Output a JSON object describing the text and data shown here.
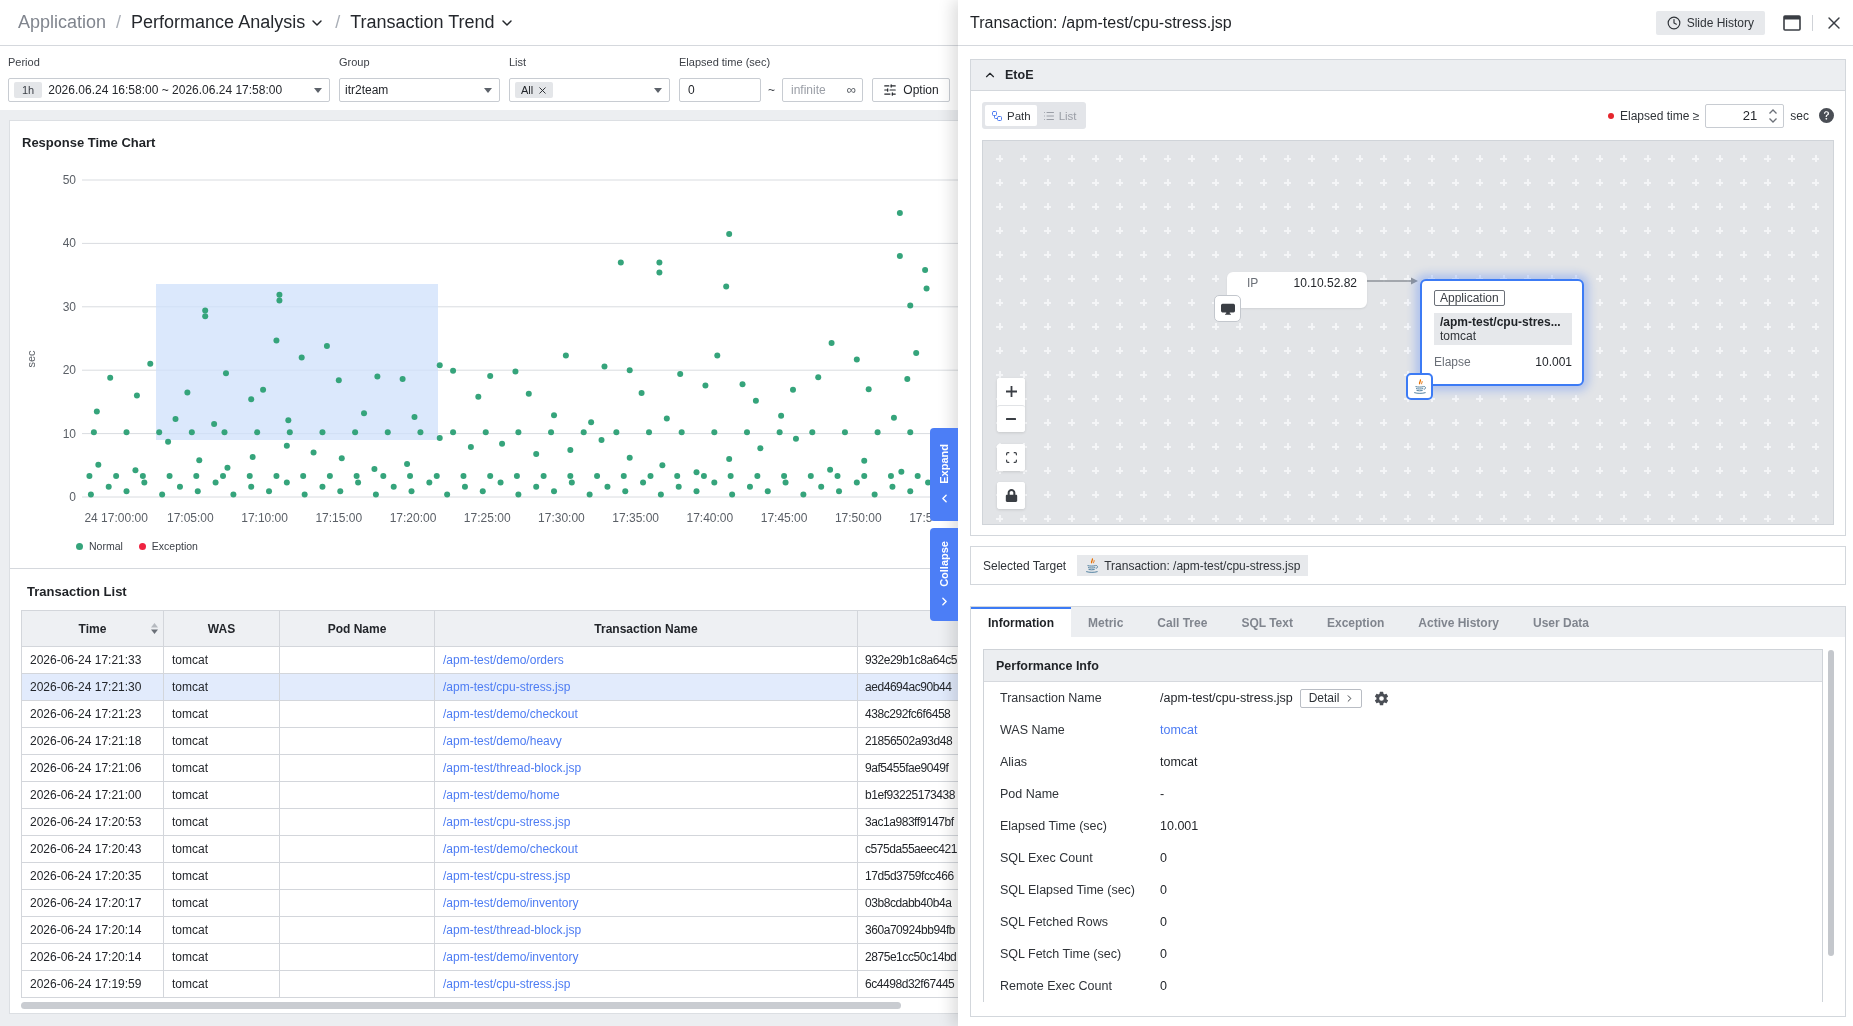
{
  "breadcrumb": [
    {
      "label": "Application",
      "dropdown": false
    },
    {
      "separator": "/",
      "label": "Performance Analysis",
      "dropdown": true
    },
    {
      "separator": "/",
      "label": "Transaction Trend",
      "dropdown": true
    }
  ],
  "filters": {
    "period": {
      "label": "Period",
      "range_badge": "1h",
      "value": "2026.06.24 16:58:00 ~ 2026.06.24 17:58:00"
    },
    "group": {
      "label": "Group",
      "value": "itr2team"
    },
    "list": {
      "label": "List",
      "chips": [
        "All"
      ]
    },
    "elapsed_time": {
      "label": "Elapsed time (sec)",
      "min_value": "0",
      "separator": "~",
      "max_placeholder": "infinite",
      "max_symbol": "∞"
    },
    "option_button": "Option"
  },
  "response_chart": {
    "chart_data": {
      "type": "scatter",
      "title": "Response Time Chart",
      "ylabel": "sec",
      "grid": true,
      "xlim": [
        61062,
        64603
      ],
      "ylim": [
        0,
        50
      ],
      "xticks": [
        {
          "value": 61200,
          "label": "24 17:00:00"
        },
        {
          "value": 61500,
          "label": "17:05:00"
        },
        {
          "value": 61800,
          "label": "17:10:00"
        },
        {
          "value": 62100,
          "label": "17:15:00"
        },
        {
          "value": 62400,
          "label": "17:20:00"
        },
        {
          "value": 62700,
          "label": "17:25:00"
        },
        {
          "value": 63000,
          "label": "17:30:00"
        },
        {
          "value": 63300,
          "label": "17:35:00"
        },
        {
          "value": 63600,
          "label": "17:40:00"
        },
        {
          "value": 63900,
          "label": "17:45:00"
        },
        {
          "value": 64200,
          "label": "17:50:00"
        },
        {
          "value": 64500,
          "label": "17:5"
        }
      ],
      "yticks": [
        0,
        10,
        20,
        30,
        40,
        50
      ],
      "x": [
        61098,
        61170,
        61242,
        61314,
        61386,
        61458,
        61530,
        61602,
        61674,
        61746,
        61818,
        61890,
        61962,
        62034,
        62106,
        62178,
        62250,
        62322,
        62394,
        62466,
        62538,
        62610,
        62682,
        62754,
        62826,
        62898,
        62970,
        63042,
        63114,
        63186,
        63258,
        63330,
        63402,
        63474,
        63546,
        63618,
        63690,
        63762,
        63834,
        63906,
        63978,
        64050,
        64122,
        64194,
        64266,
        64338,
        64410,
        64482,
        61092,
        61200,
        61308,
        61416,
        61524,
        61632,
        61740,
        61848,
        61956,
        62064,
        62172,
        62280,
        62388,
        62496,
        62604,
        62712,
        62820,
        62928,
        63036,
        63144,
        63252,
        63360,
        63468,
        63576,
        63684,
        63792,
        63900,
        64008,
        64116,
        64224,
        64332,
        64440,
        61110,
        61242,
        61374,
        61506,
        61638,
        61770,
        61902,
        62034,
        62166,
        62298,
        62430,
        62562,
        62694,
        62826,
        62958,
        63090,
        63222,
        63354,
        63486,
        63618,
        63750,
        63882,
        64014,
        64146,
        64278,
        64410,
        61128,
        61278,
        61410,
        61536,
        61650,
        61752,
        61890,
        61998,
        62112,
        62244,
        62376,
        62508,
        62634,
        62760,
        62898,
        63036,
        63162,
        63276,
        63408,
        63546,
        63678,
        63804,
        63948,
        64086,
        64224,
        64374,
        61122,
        61176,
        61284,
        61338,
        61440,
        61488,
        61596,
        61644,
        61746,
        61794,
        61848,
        61896,
        61950,
        62052,
        62100,
        62202,
        62256,
        62358,
        62406,
        62508,
        62562,
        62664,
        62712,
        62814,
        62868,
        62970,
        63018,
        63120,
        63174,
        63276,
        63324,
        63426,
        63480,
        63582,
        63630,
        63732,
        63786,
        63888,
        63936,
        64038,
        64092,
        64194,
        64242,
        64344,
        64398,
        61560,
        61560,
        61860,
        61860,
        63240,
        63396,
        63396,
        63678,
        63666,
        64368,
        64368,
        64410,
        64470,
        64476,
        64434
      ],
      "series": [
        {
          "name": "Normal",
          "color": "#35a47b",
          "values": [
            0.4,
            1.6,
            0.9,
            2.3,
            0.4,
            1.6,
            0.9,
            2.3,
            0.4,
            1.6,
            0.9,
            2.3,
            0.4,
            1.6,
            0.9,
            2.3,
            0.4,
            1.6,
            0.9,
            2.3,
            0.4,
            1.6,
            0.9,
            2.3,
            0.4,
            1.6,
            0.9,
            2.3,
            0.4,
            1.6,
            0.9,
            2.3,
            0.4,
            1.6,
            0.9,
            2.3,
            0.4,
            1.6,
            0.9,
            2.3,
            0.4,
            1.6,
            0.9,
            2.3,
            0.4,
            1.6,
            0.9,
            2.3,
            3.3,
            3.3,
            3.3,
            3.3,
            3.3,
            3.3,
            3.3,
            3.3,
            3.3,
            3.3,
            3.3,
            3.3,
            3.3,
            3.3,
            3.3,
            3.3,
            3.3,
            3.3,
            3.3,
            3.3,
            3.3,
            3.3,
            3.3,
            3.3,
            3.3,
            3.3,
            3.3,
            3.3,
            3.3,
            3.3,
            3.3,
            3.3,
            10.2,
            10.2,
            10.2,
            10.2,
            10.2,
            10.2,
            10.2,
            10.2,
            10.2,
            10.2,
            10.2,
            10.2,
            10.2,
            10.2,
            10.2,
            10.2,
            10.2,
            10.2,
            10.2,
            10.2,
            10.2,
            10.2,
            10.2,
            10.2,
            10.2,
            10.2,
            5.1,
            4.2,
            8.7,
            5.8,
            4.6,
            6.3,
            8.1,
            7.0,
            6.1,
            4.4,
            5.2,
            9.3,
            7.9,
            8.4,
            6.8,
            7.4,
            9.0,
            6.2,
            5.0,
            3.9,
            6.0,
            7.7,
            9.2,
            4.3,
            5.7,
            4.0,
            13.5,
            18.8,
            16.0,
            21.0,
            12.3,
            16.5,
            11.5,
            19.5,
            15.4,
            16.9,
            24.7,
            12.1,
            22.0,
            23.8,
            18.4,
            13.2,
            19.0,
            18.6,
            12.6,
            20.8,
            19.9,
            15.8,
            19.1,
            19.8,
            16.3,
            12.9,
            22.3,
            11.8,
            20.6,
            20.0,
            16.4,
            12.4,
            19.4,
            17.6,
            22.3,
            17.8,
            15.2,
            12.8,
            16.9,
            18.9,
            24.3,
            21.7,
            17.0,
            12.5,
            18.6,
            29.4,
            28.5,
            31.9,
            31.0,
            37.0,
            37.0,
            35.4,
            41.5,
            33.2,
            44.8,
            38.0,
            30.2,
            35.8,
            32.9,
            22.7
          ]
        }
      ]
    },
    "legend": [
      {
        "label": "Exception",
        "color": "#ef2341"
      }
    ]
  },
  "transaction_list": {
    "title": "Transaction List",
    "columns": [
      {
        "label": "Time",
        "sortable": true
      },
      {
        "label": "WAS",
        "sortable": false
      },
      {
        "label": "Pod Name",
        "sortable": false
      },
      {
        "label": "Transaction Name",
        "sortable": false
      }
    ],
    "rows": [
      {
        "time": "2026-06-24 17:21:33",
        "was": "tomcat",
        "transaction_name": "/apm-test/demo/orders",
        "column_5": "932e29b1c8a64c5",
        "selected": false
      },
      {
        "time": "2026-06-24 17:21:30",
        "was": "tomcat",
        "transaction_name": "/apm-test/cpu-stress.jsp",
        "column_5": "aed4694ac90b44",
        "selected": true
      },
      {
        "time": "2026-06-24 17:21:23",
        "was": "tomcat",
        "transaction_name": "/apm-test/demo/checkout",
        "column_5": "438c292fc6f6458",
        "selected": false
      },
      {
        "time": "2026-06-24 17:21:18",
        "was": "tomcat",
        "transaction_name": "/apm-test/demo/heavy",
        "column_5": "21856502a93d48",
        "selected": false
      },
      {
        "time": "2026-06-24 17:21:06",
        "was": "tomcat",
        "transaction_name": "/apm-test/thread-block.jsp",
        "column_5": "9af5455fae9049f",
        "selected": false
      },
      {
        "time": "2026-06-24 17:21:00",
        "was": "tomcat",
        "transaction_name": "/apm-test/demo/home",
        "column_5": "b1ef93225173438",
        "selected": false
      },
      {
        "time": "2026-06-24 17:20:53",
        "was": "tomcat",
        "transaction_name": "/apm-test/cpu-stress.jsp",
        "column_5": "3ac1a983ff9147bf",
        "selected": false
      },
      {
        "time": "2026-06-24 17:20:43",
        "was": "tomcat",
        "transaction_name": "/apm-test/demo/checkout",
        "column_5": "c575da55aeec421",
        "selected": false
      },
      {
        "time": "2026-06-24 17:20:35",
        "was": "tomcat",
        "transaction_name": "/apm-test/cpu-stress.jsp",
        "column_5": "17d5d3759fcc466",
        "selected": false
      },
      {
        "time": "2026-06-24 17:20:17",
        "was": "tomcat",
        "transaction_name": "/apm-test/demo/inventory",
        "column_5": "03b8cdabb40b4a",
        "selected": false
      },
      {
        "time": "2026-06-24 17:20:14",
        "was": "tomcat",
        "transaction_name": "/apm-test/thread-block.jsp",
        "column_5": "360a70924bb94fb",
        "selected": false
      },
      {
        "time": "2026-06-24 17:20:14",
        "was": "tomcat",
        "transaction_name": "/apm-test/demo/inventory",
        "column_5": "2875e1cc50c14bd",
        "selected": false
      },
      {
        "time": "2026-06-24 17:19:59",
        "was": "tomcat",
        "transaction_name": "/apm-test/cpu-stress.jsp",
        "column_5": "6c4498d32f67445",
        "selected": false
      }
    ]
  },
  "panel_tabs": [
    {
      "kind": "expand",
      "label": "Expand"
    },
    {
      "kind": "collapse",
      "label": "Collapse"
    }
  ],
  "drawer": {
    "title": "Transaction: /apm-test/cpu-stress.jsp",
    "history_button": "Slide History",
    "etoe": {
      "title": "EtoE",
      "expanded": true,
      "view_toggle": [
        {
          "kind": "path",
          "label": "Path",
          "selected": true
        },
        {
          "kind": "list",
          "label": "List",
          "selected": false
        }
      ],
      "threshold": {
        "label": "Elapsed time ≥",
        "value": "21",
        "unit": "sec"
      },
      "nodes": [
        {
          "kind": "client",
          "label": "IP",
          "value": "10.10.52.82",
          "selected": false
        },
        {
          "kind": "application",
          "tag": "Application",
          "name": "/apm-test/cpu-stres...",
          "server": "tomcat",
          "metric_label": "Elapse",
          "metric_value": "10.001",
          "selected": true
        }
      ]
    },
    "selected_target": {
      "label": "Selected Target",
      "value": "Transaction: /apm-test/cpu-stress.jsp"
    },
    "tabs": [
      {
        "label": "Information",
        "selected": true
      },
      {
        "label": "Metric",
        "selected": false
      },
      {
        "label": "Call Tree",
        "selected": false
      },
      {
        "label": "SQL Text",
        "selected": false
      },
      {
        "label": "Exception",
        "selected": false
      },
      {
        "label": "Active History",
        "selected": false
      },
      {
        "label": "User Data",
        "selected": false
      }
    ],
    "performance_info": {
      "title": "Performance Info",
      "rows": [
        {
          "kind": "detail",
          "label": "Transaction Name",
          "value": "/apm-test/cpu-stress.jsp",
          "button": "Detail"
        },
        {
          "kind": "link",
          "label": "WAS Name",
          "value": "tomcat"
        },
        {
          "kind": "text",
          "label": "Alias",
          "value": "tomcat"
        },
        {
          "kind": "text",
          "label": "Pod Name",
          "value": "-"
        },
        {
          "kind": "text",
          "label": "Elapsed Time (sec)",
          "value": "10.001"
        },
        {
          "kind": "text",
          "label": "SQL Exec Count",
          "value": "0"
        },
        {
          "kind": "text",
          "label": "SQL Elapsed Time (sec)",
          "value": "0"
        },
        {
          "kind": "text",
          "label": "SQL Fetched Rows",
          "value": "0"
        },
        {
          "kind": "text",
          "label": "SQL Fetch Time (sec)",
          "value": "0"
        },
        {
          "kind": "text",
          "label": "Remote Exec Count",
          "value": "0"
        }
      ]
    }
  }
}
